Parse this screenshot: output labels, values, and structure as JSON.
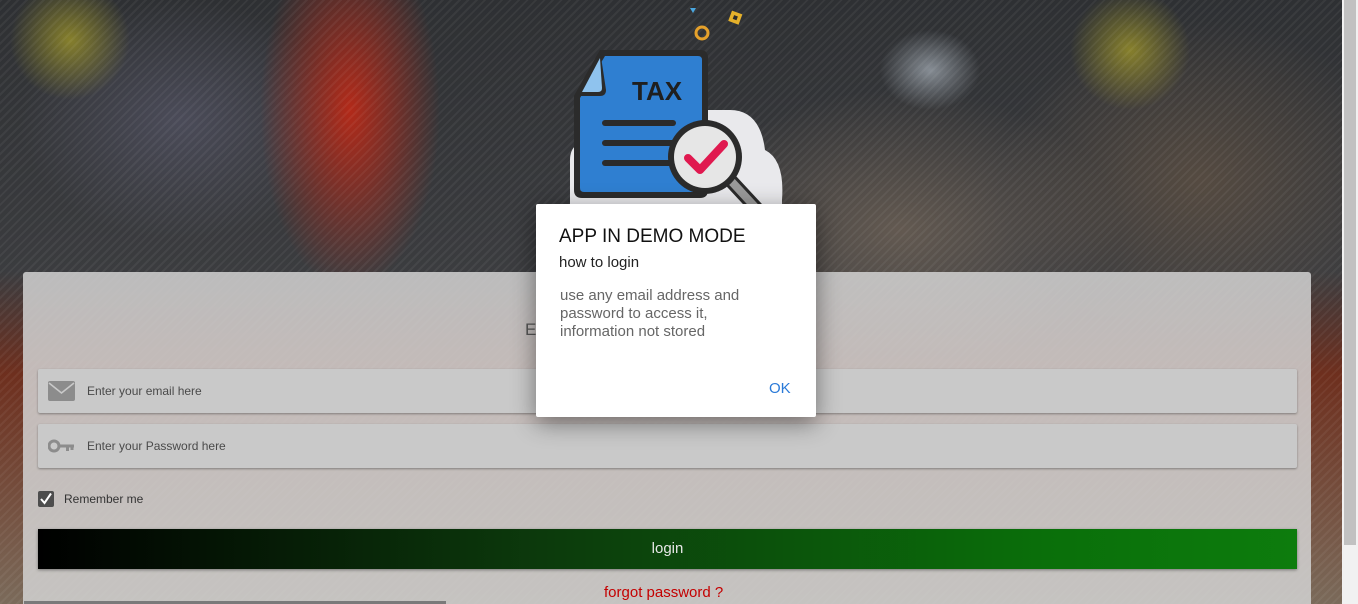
{
  "dialog": {
    "title": "APP IN DEMO MODE",
    "subtitle": "how to login",
    "message": "use any email address and password to access it, information not stored",
    "ok_label": "OK"
  },
  "logo": {
    "text": "TAX"
  },
  "login_form": {
    "heading_partial": "E",
    "email_placeholder": "Enter your email here",
    "password_placeholder": "Enter your Password here",
    "remember_label": "Remember me",
    "remember_checked": true,
    "login_label": "login",
    "forgot_label": "forgot password ?"
  },
  "colors": {
    "login_gradient_start": "#000000",
    "login_gradient_end": "#0d7c0d",
    "forgot_link": "#c40000",
    "dialog_action": "#2a7ad8",
    "logo_blue": "#2f7fd1",
    "logo_check": "#e0194f"
  },
  "icons": {
    "email": "envelope-icon",
    "password": "key-icon",
    "remember": "checkmark-icon"
  }
}
